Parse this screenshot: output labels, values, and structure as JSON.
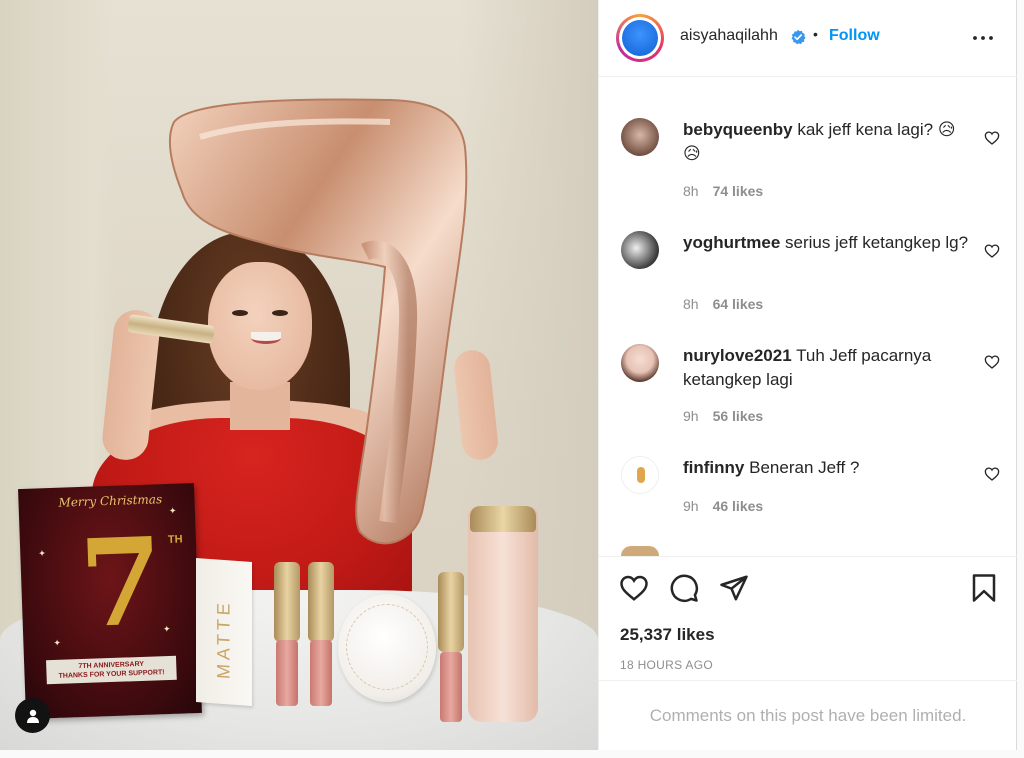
{
  "post": {
    "username": "aisyahaqilahh",
    "follow_label": "Follow",
    "separator": "•",
    "likes_text": "25,337 likes",
    "time_text": "18 HOURS AGO",
    "comments_limited": "Comments on this post have been limited."
  },
  "photo": {
    "card_script": "Merry Christmas",
    "card_number": "7",
    "card_th": "TH",
    "card_banner_line1": "7TH ANNIVERSARY",
    "card_banner_line2": "THANKS FOR YOUR SUPPORT!",
    "box_text": "MATTE"
  },
  "comments": [
    {
      "user": "bebyqueenby",
      "text": "kak jeff kena lagi? 😥 😥",
      "age": "8h",
      "likes": "74 likes"
    },
    {
      "user": "yoghurtmee",
      "text": "serius jeff ketangkep lg?",
      "age": "8h",
      "likes": "64 likes"
    },
    {
      "user": "nurylove2021",
      "text": "Tuh Jeff pacarnya ketangkep lagi",
      "age": "9h",
      "likes": "56 likes"
    },
    {
      "user": "finfinny",
      "text": "Beneran Jeff ?",
      "age": "9h",
      "likes": "46 likes"
    }
  ],
  "colors": {
    "follow_blue": "#0095f6",
    "text_primary": "#262626",
    "text_secondary": "#8e8e8e",
    "verified_blue": "#3897f0"
  },
  "icons": [
    "verified-badge-icon",
    "more-options-icon",
    "heart-icon",
    "comment-icon",
    "share-icon",
    "bookmark-icon",
    "user-tag-icon"
  ]
}
